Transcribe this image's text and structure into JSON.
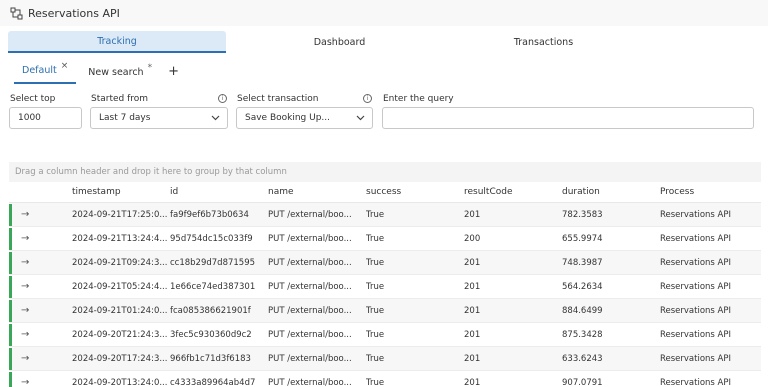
{
  "app": {
    "title": "Reservations API",
    "icon": "api-icon"
  },
  "main_tabs": [
    {
      "label": "Tracking",
      "active": true
    },
    {
      "label": "Dashboard",
      "active": false
    },
    {
      "label": "Transactions",
      "active": false
    }
  ],
  "sub_tabs": {
    "items": [
      {
        "label": "Default",
        "close": "×",
        "active": true
      },
      {
        "label": "New search",
        "modified": "*",
        "active": false
      }
    ],
    "add": "+"
  },
  "filters": {
    "select_top": {
      "label": "Select top",
      "value": "1000"
    },
    "started_from": {
      "label": "Started from",
      "value": "Last 7 days"
    },
    "select_transaction": {
      "label": "Select transaction",
      "value": "Save Booking Up..."
    },
    "query": {
      "label": "Enter the query",
      "value": ""
    }
  },
  "group_hint": "Drag a column header and drop it here to group by that column",
  "columns": [
    "timestamp",
    "id",
    "name",
    "success",
    "resultCode",
    "duration",
    "Process"
  ],
  "expand_glyph": "→",
  "rows": [
    {
      "timestamp": "2024-09-21T17:25:0...",
      "id": "fa9f9ef6b73b0634",
      "name": "PUT /external/boo...",
      "success": "True",
      "resultCode": "201",
      "duration": "782.3583",
      "process": "Reservations API"
    },
    {
      "timestamp": "2024-09-21T13:24:4...",
      "id": "95d754dc15c033f9",
      "name": "PUT /external/boo...",
      "success": "True",
      "resultCode": "200",
      "duration": "655.9974",
      "process": "Reservations API"
    },
    {
      "timestamp": "2024-09-21T09:24:3...",
      "id": "cc18b29d7d871595",
      "name": "PUT /external/boo...",
      "success": "True",
      "resultCode": "201",
      "duration": "748.3987",
      "process": "Reservations API"
    },
    {
      "timestamp": "2024-09-21T05:24:4...",
      "id": "1e66ce74ed387301",
      "name": "PUT /external/boo...",
      "success": "True",
      "resultCode": "201",
      "duration": "564.2634",
      "process": "Reservations API"
    },
    {
      "timestamp": "2024-09-21T01:24:0...",
      "id": "fca085386621901f",
      "name": "PUT /external/boo...",
      "success": "True",
      "resultCode": "201",
      "duration": "884.6499",
      "process": "Reservations API"
    },
    {
      "timestamp": "2024-09-20T21:24:3...",
      "id": "3fec5c930360d9c2",
      "name": "PUT /external/boo...",
      "success": "True",
      "resultCode": "201",
      "duration": "875.3428",
      "process": "Reservations API"
    },
    {
      "timestamp": "2024-09-20T17:24:3...",
      "id": "966fb1c71d3f6183",
      "name": "PUT /external/boo...",
      "success": "True",
      "resultCode": "201",
      "duration": "633.6243",
      "process": "Reservations API"
    },
    {
      "timestamp": "2024-09-20T13:24:0...",
      "id": "c4333a89964ab4d7",
      "name": "PUT /external/boo...",
      "success": "True",
      "resultCode": "201",
      "duration": "907.0791",
      "process": "Reservations API"
    }
  ],
  "colors": {
    "accent": "#2d6fb0",
    "status_success": "#3aa657"
  }
}
